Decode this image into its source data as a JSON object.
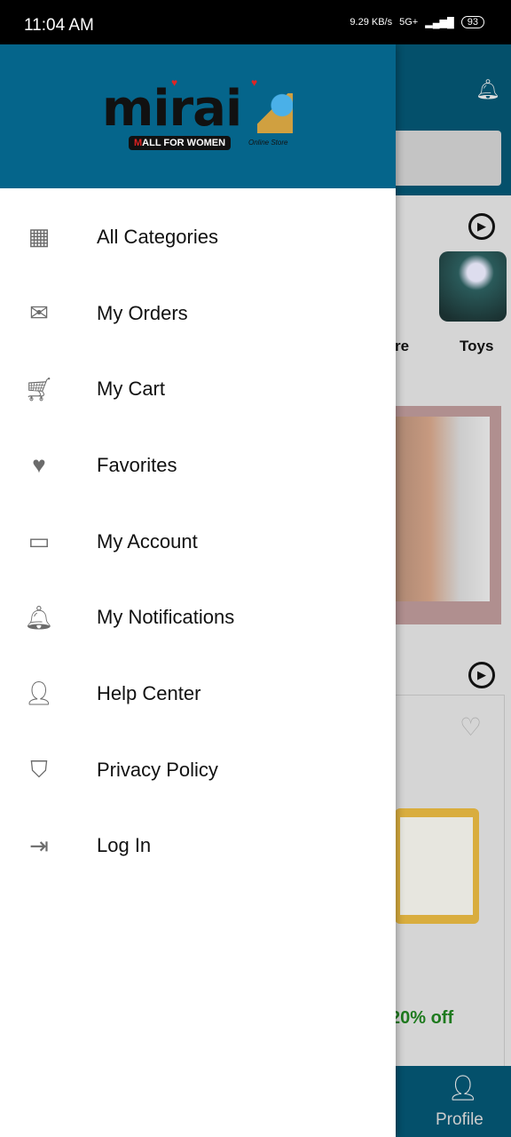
{
  "status_bar": {
    "time": "11:04 AM",
    "speed": "9.29 KB/s",
    "network": "5G+",
    "battery": "93"
  },
  "background": {
    "category_partial": "re",
    "category_toys": "Toys",
    "discount": "20% off",
    "bottom_nav_profile": "Profile"
  },
  "drawer": {
    "logo": {
      "word": "mirai",
      "tagline_first": "M",
      "tagline_rest": "ALL FOR WOMEN",
      "sub": "Online Store"
    },
    "items": [
      {
        "label": "All Categories",
        "icon": "grid-icon"
      },
      {
        "label": "My Orders",
        "icon": "envelope-open-icon"
      },
      {
        "label": "My Cart",
        "icon": "cart-icon"
      },
      {
        "label": "Favorites",
        "icon": "heart-icon"
      },
      {
        "label": "My Account",
        "icon": "credit-card-icon"
      },
      {
        "label": "My Notifications",
        "icon": "bell-icon"
      },
      {
        "label": "Help Center",
        "icon": "person-add-icon"
      },
      {
        "label": "Privacy Policy",
        "icon": "shield-icon"
      },
      {
        "label": "Log In",
        "icon": "login-icon"
      }
    ]
  },
  "colors": {
    "drawer_header": "#05658b",
    "app_header_dimmed": "#04506b",
    "discount": "#1e7a1e"
  }
}
